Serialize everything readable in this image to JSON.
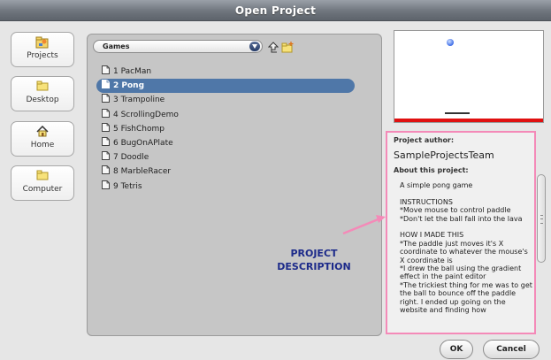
{
  "dialog": {
    "title": "Open Project"
  },
  "places": [
    {
      "label": "Projects",
      "icon": "projects-icon"
    },
    {
      "label": "Desktop",
      "icon": "folder-icon"
    },
    {
      "label": "Home",
      "icon": "home-icon"
    },
    {
      "label": "Computer",
      "icon": "folder-icon"
    }
  ],
  "browser": {
    "current_folder": "Games",
    "files": [
      {
        "label": "1 PacMan",
        "selected": false
      },
      {
        "label": "2 Pong",
        "selected": true
      },
      {
        "label": "3 Trampoline",
        "selected": false
      },
      {
        "label": "4 ScrollingDemo",
        "selected": false
      },
      {
        "label": "5 FishChomp",
        "selected": false
      },
      {
        "label": "6 BugOnAPlate",
        "selected": false
      },
      {
        "label": "7 Doodle",
        "selected": false
      },
      {
        "label": "8 MarbleRacer",
        "selected": false
      },
      {
        "label": "9 Tetris",
        "selected": false
      }
    ]
  },
  "info": {
    "author_label": "Project author:",
    "author": "SampleProjectsTeam",
    "about_label": "About this project:",
    "notes": "A simple pong game\n\nINSTRUCTIONS\n*Move mouse to control paddle\n*Don't let the ball fall into the lava\n\nHOW I MADE THIS\n*The paddle just moves it's X coordinate to whatever the mouse's X coordinate is\n*I drew the ball using the gradient effect in the paint editor\n*The trickiest thing for me was to get the ball to bounce off the paddle right. I ended up going on the website and finding how"
  },
  "annotation": {
    "line1": "PROJECT",
    "line2": "DESCRIPTION",
    "color": "#1c2a8a",
    "arrow_color": "#f48ab8"
  },
  "buttons": {
    "ok": "OK",
    "cancel": "Cancel"
  },
  "colors": {
    "selection": "#4f77a8",
    "lava": "#e01010",
    "ball": "#3f6ee8",
    "callout_border": "#f48ab8"
  }
}
